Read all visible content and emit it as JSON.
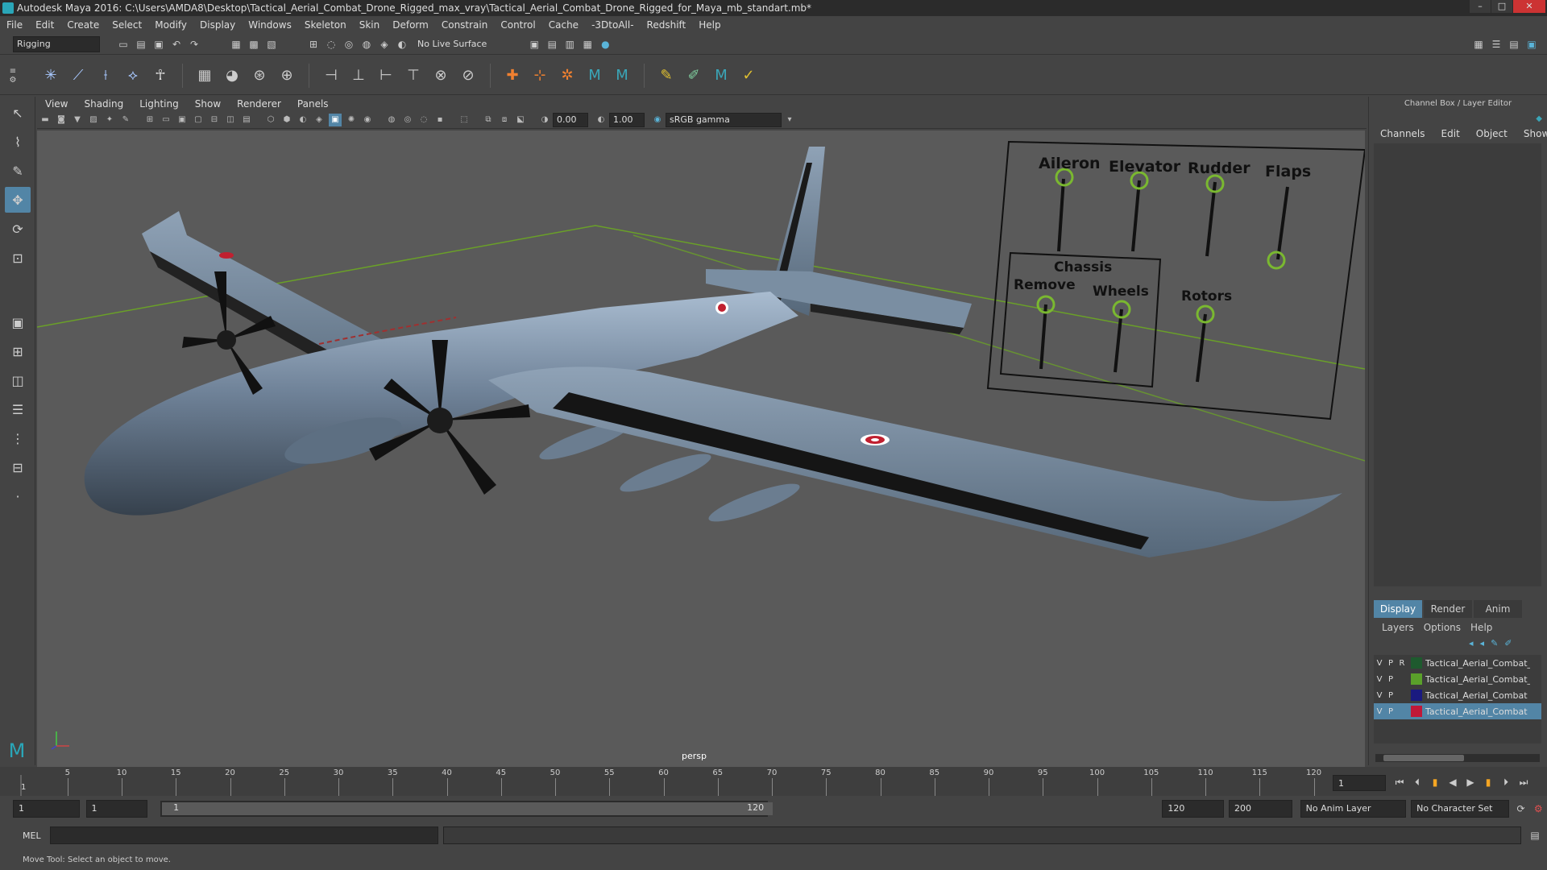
{
  "title": "Autodesk Maya 2016: C:\\Users\\AMDA8\\Desktop\\Tactical_Aerial_Combat_Drone_Rigged_max_vray\\Tactical_Aerial_Combat_Drone_Rigged_for_Maya_mb_standart.mb*",
  "menu": [
    "File",
    "Edit",
    "Create",
    "Select",
    "Modify",
    "Display",
    "Windows",
    "Skeleton",
    "Skin",
    "Deform",
    "Constrain",
    "Control",
    "Cache",
    "-3DtoAll-",
    "Redshift",
    "Help"
  ],
  "status": {
    "mode": "Rigging",
    "live_surface": "No Live Surface"
  },
  "viewport_menu": [
    "View",
    "Shading",
    "Lighting",
    "Show",
    "Renderer",
    "Panels"
  ],
  "viewport_fields": {
    "exposure": "0.00",
    "gamma": "1.00",
    "colorspace": "sRGB gamma"
  },
  "camera_label": "persp",
  "rig_labels": {
    "aileron": "Aileron",
    "elevator": "Elevator",
    "rudder": "Rudder",
    "flaps": "Flaps",
    "chassis": "Chassis",
    "remove": "Remove",
    "wheels": "Wheels",
    "rotors": "Rotors"
  },
  "right_panel": {
    "header": "Channel Box / Layer Editor",
    "tabs": [
      "Channels",
      "Edit",
      "Object",
      "Show"
    ],
    "display_tabs": [
      "Display",
      "Render",
      "Anim"
    ],
    "layer_menu": [
      "Layers",
      "Options",
      "Help"
    ],
    "layers": [
      {
        "v": "V",
        "p": "P",
        "r": "R",
        "name": "Tactical_Aerial_Combat_Drone",
        "color": "#1e5a2e"
      },
      {
        "v": "V",
        "p": "P",
        "r": "",
        "name": "Tactical_Aerial_Combat_",
        "color": "#5aa02a"
      },
      {
        "v": "V",
        "p": "P",
        "r": "",
        "name": "Tactical_Aerial_Combat",
        "color": "#1a1a80"
      },
      {
        "v": "V",
        "p": "P",
        "r": "",
        "name": "Tactical_Aerial_Combat",
        "color": "#c01838"
      }
    ]
  },
  "timeline": {
    "ticks": [
      "5",
      "10",
      "15",
      "20",
      "25",
      "30",
      "35",
      "40",
      "45",
      "50",
      "55",
      "60",
      "65",
      "70",
      "75",
      "80",
      "85",
      "90",
      "95",
      "100",
      "105",
      "110",
      "115",
      "120"
    ],
    "start_marker": "1",
    "current_frame": "1"
  },
  "range": {
    "start": "1",
    "start2": "1",
    "slider_start": "1",
    "slider_end": "120",
    "end": "120",
    "total_end": "200",
    "anim_layer": "No Anim Layer",
    "char_set": "No Character Set"
  },
  "cmd": {
    "label": "MEL"
  },
  "help_text": "Move Tool: Select an object to move."
}
